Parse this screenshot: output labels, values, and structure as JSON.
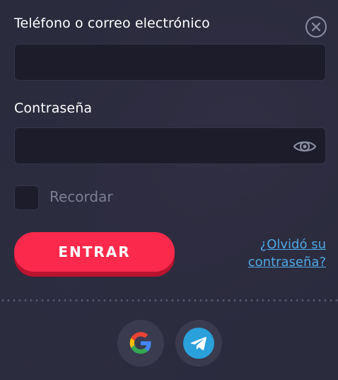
{
  "form": {
    "phone_label": "Teléfono o correo electrónico",
    "phone_value": "",
    "password_label": "Contraseña",
    "password_value": "",
    "remember_label": "Recordar",
    "remember_checked": false,
    "submit_label": "ENTRAR",
    "forgot_line1": "¿Olvidó su",
    "forgot_line2": "contraseña?"
  },
  "icons": {
    "close": "close-icon",
    "eye": "eye-icon",
    "google": "google-icon",
    "telegram": "telegram-icon"
  },
  "colors": {
    "background": "#2a2b3d",
    "input_bg": "#1c1c2b",
    "accent": "#fb2a4c",
    "link": "#4fa8e6",
    "telegram": "#2aa1db"
  }
}
